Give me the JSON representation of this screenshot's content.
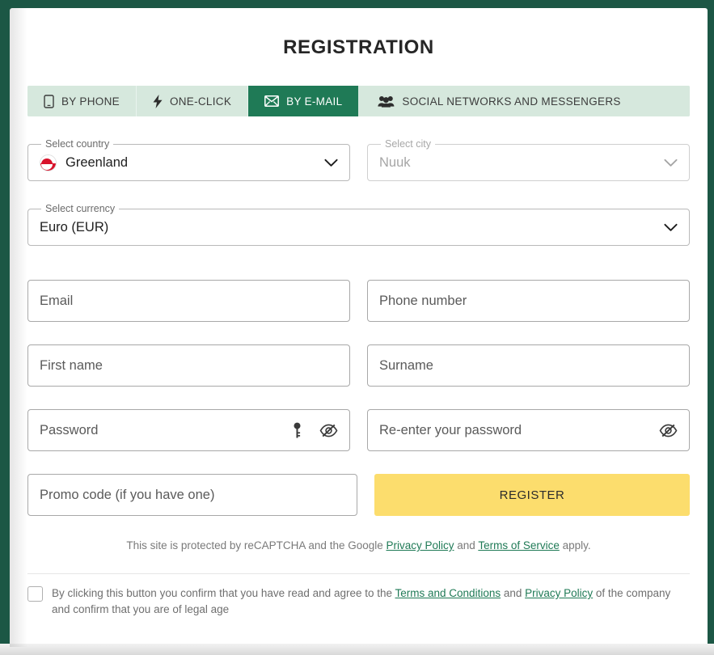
{
  "modal": {
    "title": "REGISTRATION"
  },
  "tabs": [
    {
      "label": "BY PHONE",
      "icon": "mobile-phone-icon",
      "active": false
    },
    {
      "label": "ONE-CLICK",
      "icon": "lightning-bolt-icon",
      "active": false
    },
    {
      "label": "BY E-MAIL",
      "icon": "envelope-icon",
      "active": true
    },
    {
      "label": "SOCIAL NETWORKS AND MESSENGERS",
      "icon": "users-group-icon",
      "active": false
    }
  ],
  "selects": {
    "country": {
      "legend": "Select country",
      "value": "Greenland",
      "flag": "greenland-flag-icon",
      "disabled": false
    },
    "city": {
      "legend": "Select city",
      "value": "Nuuk",
      "disabled": true
    },
    "currency": {
      "legend": "Select currency",
      "value": "Euro (EUR)",
      "disabled": false
    }
  },
  "fields": {
    "email": {
      "placeholder": "Email",
      "value": ""
    },
    "phone": {
      "placeholder": "Phone number",
      "value": ""
    },
    "first_name": {
      "placeholder": "First name",
      "value": ""
    },
    "surname": {
      "placeholder": "Surname",
      "value": ""
    },
    "password": {
      "placeholder": "Password",
      "value": ""
    },
    "password_repeat": {
      "placeholder": "Re-enter your password",
      "value": ""
    },
    "promo": {
      "placeholder": "Promo code (if you have one)",
      "value": ""
    }
  },
  "buttons": {
    "register": "REGISTER"
  },
  "recaptcha": {
    "text_before": "This site is protected by reCAPTCHA and the Google ",
    "link_privacy": "Privacy Policy",
    "text_middle": " and ",
    "link_terms": "Terms of Service",
    "text_after": " apply."
  },
  "terms": {
    "text_before": "By clicking this button you confirm that you have read and agree to the ",
    "link_terms": "Terms and Conditions",
    "text_middle": " and ",
    "link_privacy": "Privacy Policy",
    "text_after": " of the company and confirm that you are of legal age",
    "checked": false
  },
  "colors": {
    "brand_green_dark": "#1c5745",
    "tab_active_green": "#1f7a56",
    "tab_inactive_green": "#d6e8dd",
    "register_yellow": "#fcdd6d",
    "link_green": "#1f7a56",
    "flag_red": "#d8112a"
  }
}
